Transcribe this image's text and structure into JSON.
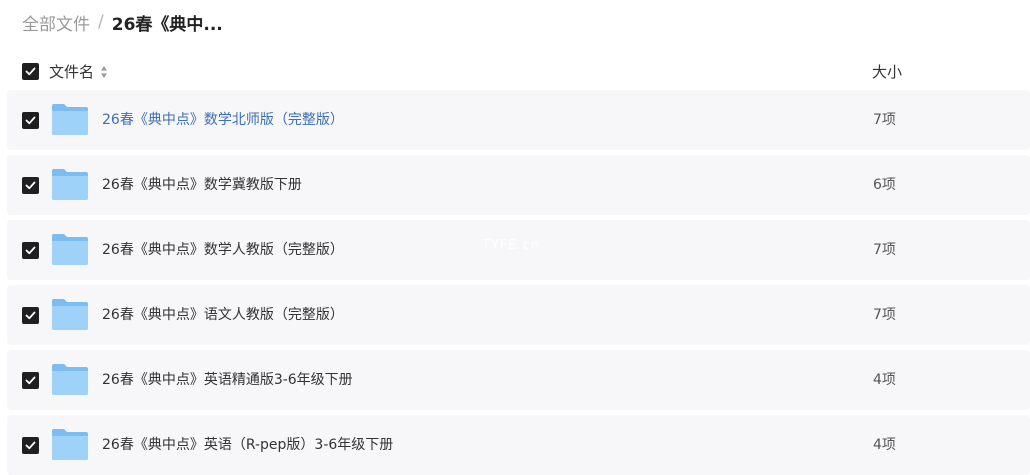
{
  "breadcrumb": {
    "root": "全部文件",
    "separator": "/",
    "current": "26春《典中..."
  },
  "header": {
    "name_label": "文件名",
    "size_label": "大小"
  },
  "files": [
    {
      "name": "26春《典中点》数学北师版（完整版）",
      "size": "7项"
    },
    {
      "name": "26春《典中点》数学冀教版下册",
      "size": "6项"
    },
    {
      "name": "26春《典中点》数学人教版（完整版）",
      "size": "7项"
    },
    {
      "name": "26春《典中点》语文人教版（完整版）",
      "size": "7项"
    },
    {
      "name": "26春《典中点》英语精通版3-6年级下册",
      "size": "4项"
    },
    {
      "name": "26春《典中点》英语（R-pep版）3-6年级下册",
      "size": "4项"
    }
  ],
  "watermark": "TYFE.cn",
  "colors": {
    "row_background": "#f7f7f9",
    "highlight_text": "#3b6fb6",
    "checkbox": "#1f1f1f",
    "folder": "#8cc8f5"
  },
  "icons": {
    "checkbox": "checkbox-checked-icon",
    "sort": "sort-icon",
    "folder": "folder-icon"
  }
}
